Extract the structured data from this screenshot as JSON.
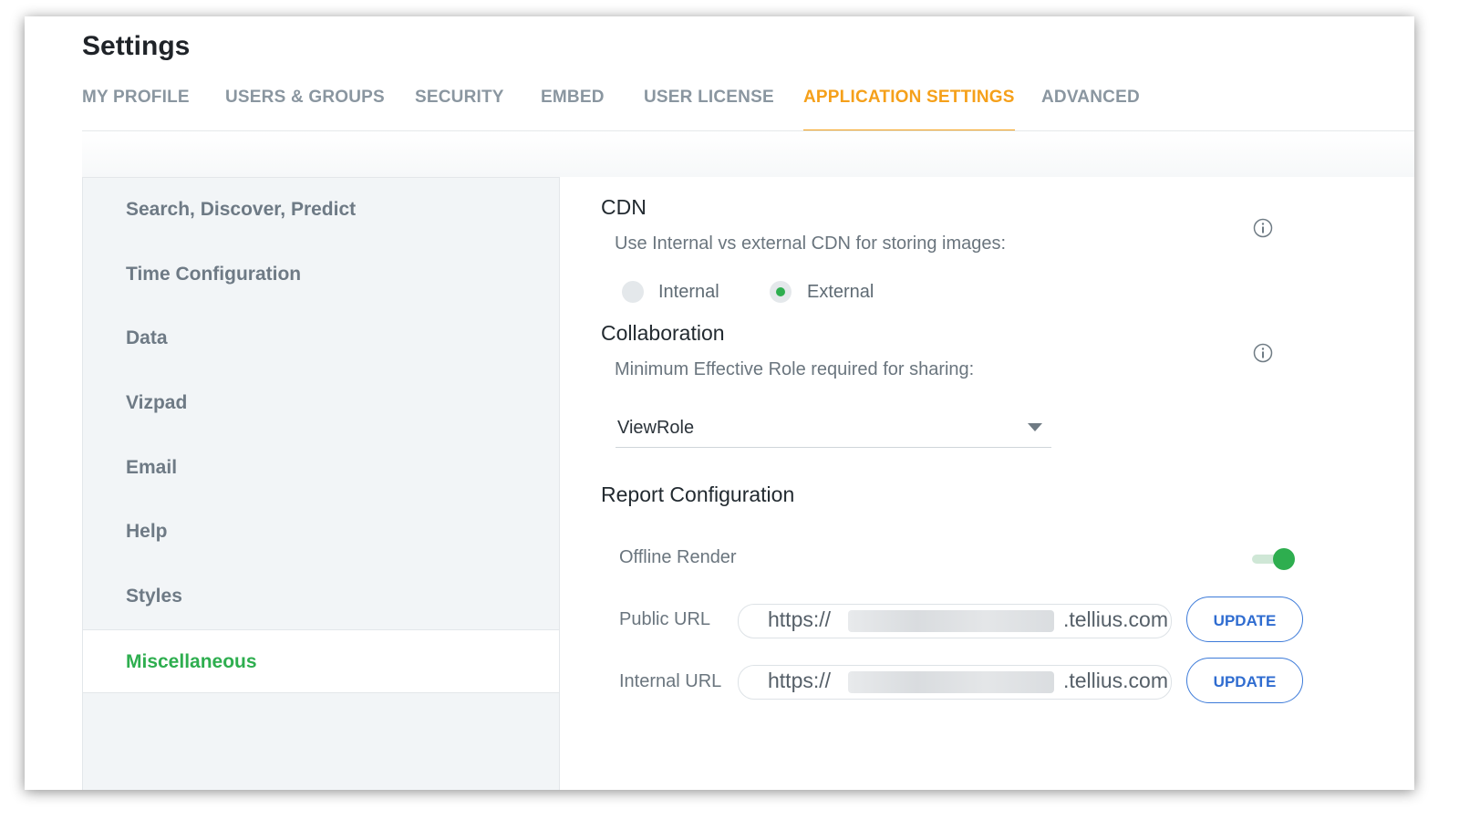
{
  "page": {
    "title": "Settings"
  },
  "tabs": [
    {
      "label": "MY PROFILE"
    },
    {
      "label": "USERS & GROUPS"
    },
    {
      "label": "SECURITY"
    },
    {
      "label": "EMBED"
    },
    {
      "label": "USER LICENSE"
    },
    {
      "label": "APPLICATION SETTINGS",
      "active": true
    },
    {
      "label": "ADVANCED"
    }
  ],
  "sidebar": {
    "items": [
      {
        "label": "Search, Discover, Predict"
      },
      {
        "label": "Time Configuration"
      },
      {
        "label": "Data"
      },
      {
        "label": "Vizpad"
      },
      {
        "label": "Email"
      },
      {
        "label": "Help"
      },
      {
        "label": "Styles"
      },
      {
        "label": "Miscellaneous",
        "active": true
      }
    ]
  },
  "cdn": {
    "title": "CDN",
    "description": "Use Internal vs external CDN for storing images:",
    "options": [
      {
        "label": "Internal",
        "selected": false
      },
      {
        "label": "External",
        "selected": true
      }
    ]
  },
  "collaboration": {
    "title": "Collaboration",
    "description": "Minimum Effective Role required for sharing:",
    "selected_role": "ViewRole"
  },
  "report": {
    "title": "Report Configuration",
    "offline_render_label": "Offline Render",
    "offline_render_enabled": true,
    "public_url_label": "Public URL",
    "public_url_prefix": "https://",
    "public_url_suffix": ".tellius.com",
    "internal_url_label": "Internal URL",
    "internal_url_prefix": "https://",
    "internal_url_suffix": ".tellius.com",
    "update_label": "UPDATE"
  },
  "colors": {
    "accent_tab": "#f5a01a",
    "accent_green": "#2eae4f",
    "button_blue": "#2f6cd0"
  }
}
